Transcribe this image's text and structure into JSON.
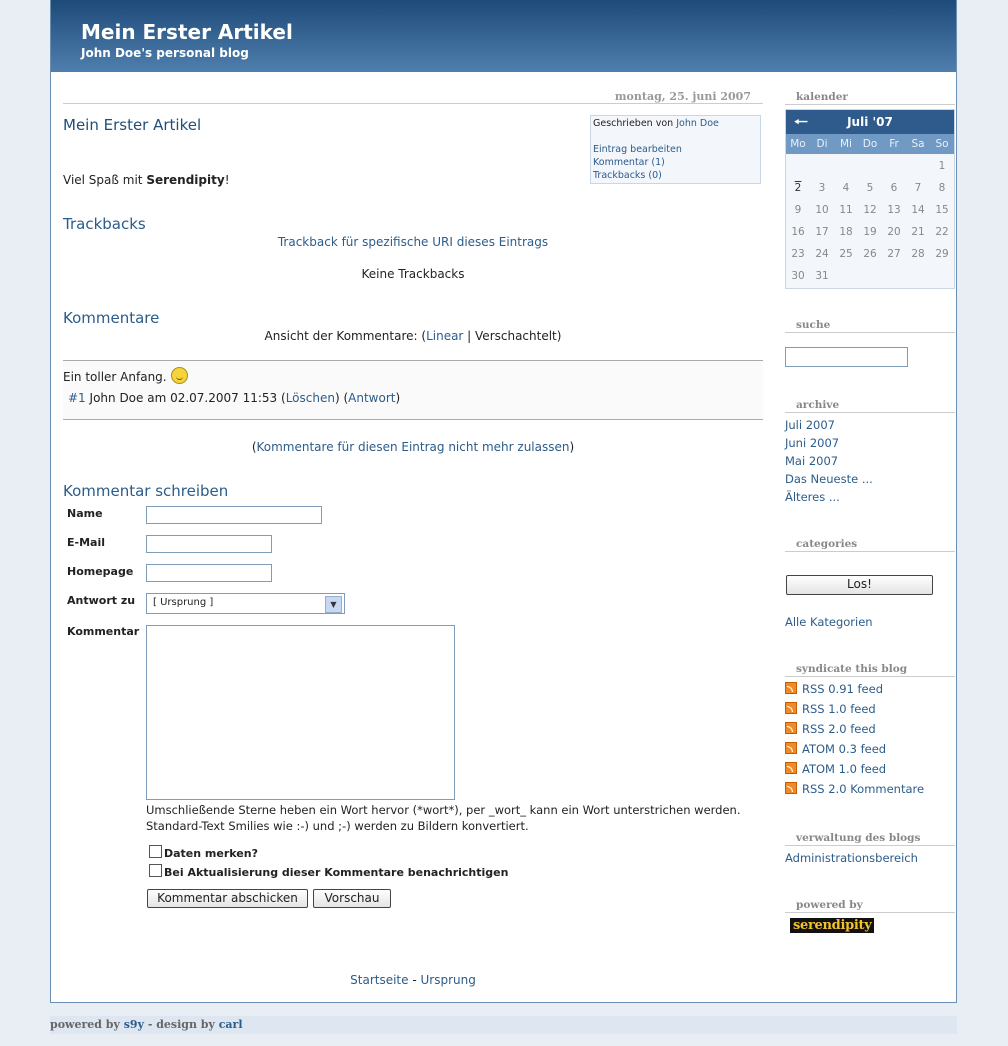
{
  "header": {
    "title": "Mein Erster Artikel",
    "subtitle": "John Doe's personal blog"
  },
  "entry": {
    "date": "montag, 25. juni 2007",
    "title": "Mein Erster Artikel",
    "meta": {
      "written_by": "Geschrieben von",
      "author": "John Doe",
      "edit": "Eintrag bearbeiten",
      "comments": "Kommentar (1)",
      "trackbacks": "Trackbacks (0)"
    },
    "body_prefix": "Viel Spaß mit ",
    "body_bold": "Serendipity",
    "body_suffix": "!"
  },
  "trackbacks": {
    "heading": "Trackbacks",
    "uri_link": "Trackback für spezifische URI dieses Eintrags",
    "none": "Keine Trackbacks"
  },
  "comments": {
    "heading": "Kommentare",
    "view_prefix": "Ansicht der Kommentare: (",
    "linear": "Linear",
    "sep": " | ",
    "threaded": "Verschachtelt",
    "view_suffix": ")",
    "items": [
      {
        "text": "Ein toller Anfang.",
        "number": "#1",
        "byline": "John Doe am 02.07.2007 11:53",
        "delete": "Löschen",
        "reply": "Antwort"
      }
    ],
    "disable_link": "Kommentare für diesen Eintrag nicht mehr zulassen"
  },
  "form": {
    "heading": "Kommentar schreiben",
    "name_label": "Name",
    "email_label": "E-Mail",
    "homepage_label": "Homepage",
    "reply_label": "Antwort zu",
    "reply_selected": "[ Ursprung ]",
    "comment_label": "Kommentar",
    "hint_line1": "Umschließende Sterne heben ein Wort hervor (*wort*), per _wort_ kann ein Wort unterstrichen werden.",
    "hint_line2": "Standard-Text Smilies wie :-) und ;-) werden zu Bildern konvertiert.",
    "remember": "Daten merken?",
    "notify": "Bei Aktualisierung dieser Kommentare benachrichtigen",
    "submit": "Kommentar abschicken",
    "preview": "Vorschau"
  },
  "footer": {
    "home": "Startseite",
    "sep": " - ",
    "origin": "Ursprung"
  },
  "sidebar": {
    "calendar": {
      "heading": "kalender",
      "month": "Juli '07",
      "prev_icon": "arrow-left-icon",
      "days": [
        "Mo",
        "Di",
        "Mi",
        "Do",
        "Fr",
        "Sa",
        "So"
      ],
      "weeks": [
        [
          "",
          "",
          "",
          "",
          "",
          "",
          "1"
        ],
        [
          "2",
          "3",
          "4",
          "5",
          "6",
          "7",
          "8"
        ],
        [
          "9",
          "10",
          "11",
          "12",
          "13",
          "14",
          "15"
        ],
        [
          "16",
          "17",
          "18",
          "19",
          "20",
          "21",
          "22"
        ],
        [
          "23",
          "24",
          "25",
          "26",
          "27",
          "28",
          "29"
        ],
        [
          "30",
          "31",
          "",
          "",
          "",
          "",
          ""
        ]
      ]
    },
    "search": {
      "heading": "suche"
    },
    "archive": {
      "heading": "archive",
      "items": [
        "Juli 2007",
        "Juni 2007",
        "Mai 2007",
        "Das Neueste ...",
        "Älteres ..."
      ]
    },
    "categories": {
      "heading": "categories",
      "button": "Los!",
      "all": "Alle Kategorien"
    },
    "syndicate": {
      "heading": "syndicate this blog",
      "feeds": [
        "RSS 0.91 feed",
        "RSS 1.0 feed",
        "RSS 2.0 feed",
        "ATOM 0.3 feed",
        "ATOM 1.0 feed",
        "RSS 2.0 Kommentare"
      ]
    },
    "admin": {
      "heading": "verwaltung des blogs",
      "link": "Administrationsbereich"
    },
    "powered": {
      "heading": "powered by",
      "logo": "serendipity"
    }
  },
  "bottom": {
    "powered_by": "powered by ",
    "s9y": "s9y",
    "design_by": " - design by ",
    "carl": "carl"
  }
}
